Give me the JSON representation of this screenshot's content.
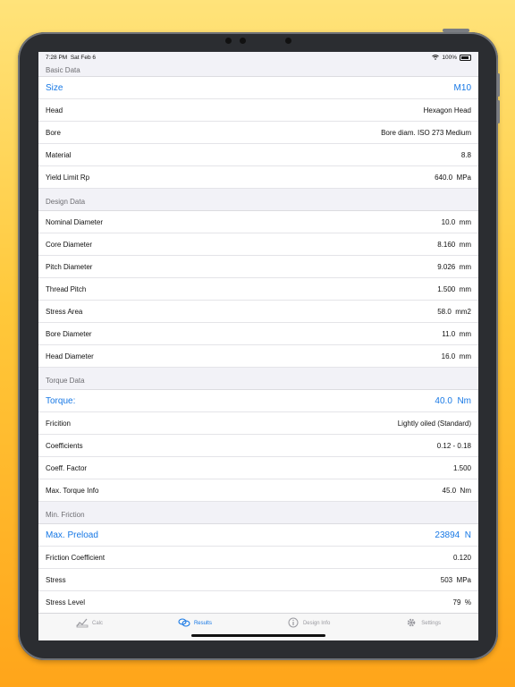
{
  "status": {
    "time": "7:28 PM",
    "date": "Sat Feb 6",
    "battery": "100%"
  },
  "sections": [
    {
      "header": "Basic Data",
      "rows": [
        {
          "label": "Size",
          "value": "M10",
          "highlight": true
        },
        {
          "label": "Head",
          "value": "Hexagon Head"
        },
        {
          "label": "Bore",
          "value": "Bore diam. ISO 273 Medium"
        },
        {
          "label": "Material",
          "value": "8.8"
        },
        {
          "label": "Yield Limit Rp",
          "value": "640.0  MPa"
        }
      ]
    },
    {
      "header": "Design Data",
      "rows": [
        {
          "label": "Nominal Diameter",
          "value": "10.0  mm"
        },
        {
          "label": "Core Diameter",
          "value": "8.160  mm"
        },
        {
          "label": "Pitch Diameter",
          "value": "9.026  mm"
        },
        {
          "label": "Thread Pitch",
          "value": "1.500  mm"
        },
        {
          "label": "Stress Area",
          "value": "58.0  mm2"
        },
        {
          "label": "Bore Diameter",
          "value": "11.0  mm"
        },
        {
          "label": "Head Diameter",
          "value": "16.0  mm"
        }
      ]
    },
    {
      "header": "Torque Data",
      "rows": [
        {
          "label": "Torque:",
          "value": "40.0  Nm",
          "highlight": true
        },
        {
          "label": "Fricition",
          "value": "Lightly oiled (Standard)"
        },
        {
          "label": "Coefficients",
          "value": "0.12 - 0.18"
        },
        {
          "label": "Coeff. Factor",
          "value": "1.500"
        },
        {
          "label": "Max. Torque Info",
          "value": "45.0  Nm"
        }
      ]
    },
    {
      "header": "Min. Friction",
      "rows": [
        {
          "label": "Max. Preload",
          "value": "23894  N",
          "highlight": true
        },
        {
          "label": "Friction Coefficient",
          "value": "0.120"
        },
        {
          "label": "Stress",
          "value": "503  MPa"
        },
        {
          "label": "Stress Level",
          "value": "79  %"
        }
      ]
    }
  ],
  "tabs": [
    {
      "label": "Calc",
      "icon": "calc-icon",
      "active": false
    },
    {
      "label": "Results",
      "icon": "results-icon",
      "active": true
    },
    {
      "label": "Design Info",
      "icon": "info-icon",
      "active": false
    },
    {
      "label": "Settings",
      "icon": "gear-icon",
      "active": false
    }
  ],
  "colors": {
    "accent": "#1778e5",
    "background_gradient_top": "#FFE37A",
    "background_gradient_bottom": "#FFA51A"
  }
}
